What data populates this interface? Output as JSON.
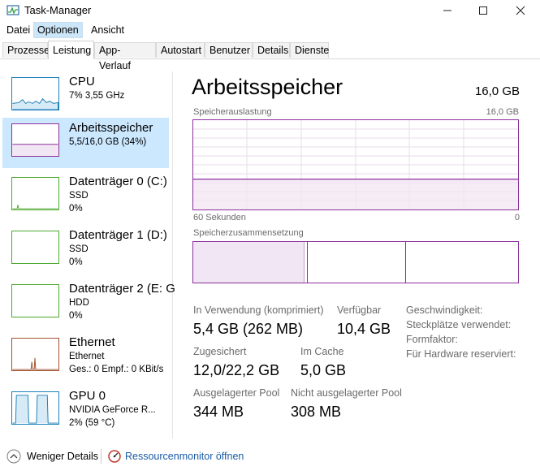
{
  "window": {
    "title": "Task-Manager"
  },
  "menu": [
    "Datei",
    "Optionen",
    "Ansicht"
  ],
  "tabs": [
    "Prozesse",
    "Leistung",
    "App-Verlauf",
    "Autostart",
    "Benutzer",
    "Details",
    "Dienste"
  ],
  "active_tab": "Leistung",
  "sidebar": [
    {
      "name": "CPU",
      "line1": "7% 3,55 GHz",
      "line2": "",
      "color": "#1a7db8",
      "selected": false
    },
    {
      "name": "Arbeitsspeicher",
      "line1": "5,5/16,0 GB (34%)",
      "line2": "",
      "color": "#8b2f9b",
      "selected": true
    },
    {
      "name": "Datenträger 0 (C:)",
      "line1": "SSD",
      "line2": "0%",
      "color": "#4ca82f",
      "selected": false
    },
    {
      "name": "Datenträger 1 (D:)",
      "line1": "SSD",
      "line2": "0%",
      "color": "#4ca82f",
      "selected": false
    },
    {
      "name": "Datenträger 2 (E: G",
      "line1": "HDD",
      "line2": "0%",
      "color": "#4ca82f",
      "selected": false
    },
    {
      "name": "Ethernet",
      "line1": "Ethernet",
      "line2": "Ges.: 0 Empf.: 0 KBit/s",
      "color": "#a0522d",
      "selected": false
    },
    {
      "name": "GPU 0",
      "line1": "NVIDIA GeForce R...",
      "line2": "2% (59 °C)",
      "color": "#1a7db8",
      "selected": false
    }
  ],
  "main": {
    "title": "Arbeitsspeicher",
    "total": "16,0 GB",
    "usage_label": "Speicherauslastung",
    "usage_max": "16,0 GB",
    "time_left": "60 Sekunden",
    "time_right": "0",
    "usage_fraction": 0.34,
    "composition_label": "Speicherzusammensetzung",
    "stats": {
      "in_use_label": "In Verwendung (komprimiert)",
      "in_use_value": "5,4 GB (262 MB)",
      "available_label": "Verfügbar",
      "available_value": "10,4 GB",
      "committed_label": "Zugesichert",
      "committed_value": "12,0/22,2 GB",
      "cached_label": "Im Cache",
      "cached_value": "5,0 GB",
      "paged_label": "Ausgelagerter Pool",
      "paged_value": "344 MB",
      "nonpaged_label": "Nicht ausgelagerter Pool",
      "nonpaged_value": "308 MB"
    },
    "right_labels": [
      "Geschwindigkeit:",
      "Steckplätze verwendet:",
      "Formfaktor:",
      "Für Hardware reserviert:"
    ]
  },
  "footer": {
    "fewer_details": "Weniger Details",
    "resource_monitor": "Ressourcenmonitor öffnen"
  }
}
